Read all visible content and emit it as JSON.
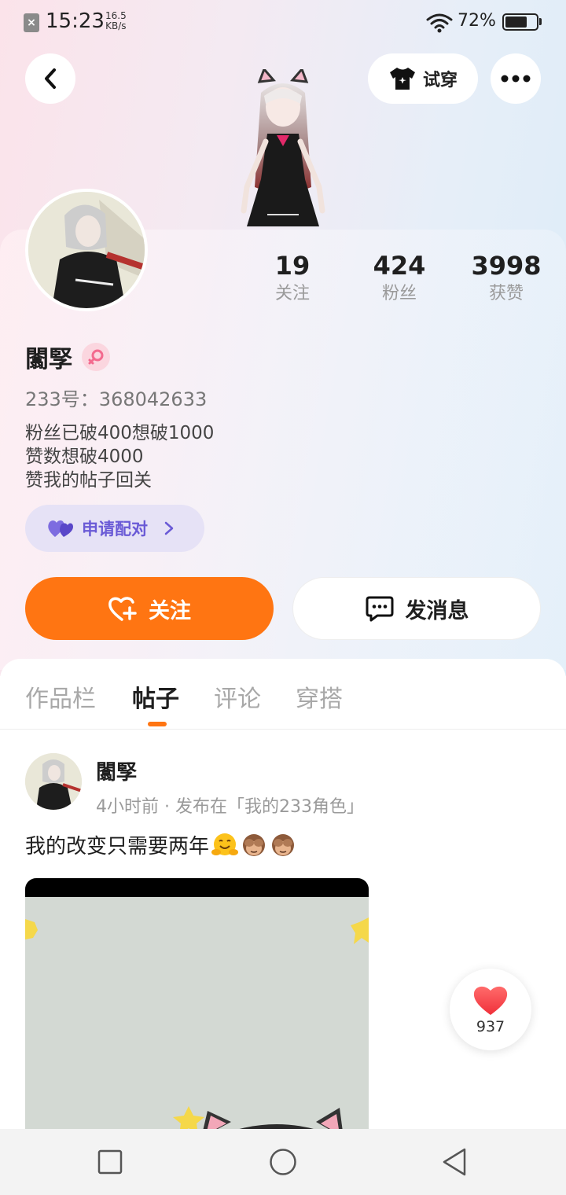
{
  "status_bar": {
    "time": "15:23",
    "net_speed_value": "16.5",
    "net_speed_unit": "KB/s",
    "battery_percent": "72%",
    "battery_level": 0.72,
    "icons": [
      "sim-disabled-icon",
      "wifi-icon",
      "battery-icon"
    ]
  },
  "header": {
    "try_on_label": "试穿",
    "icons": [
      "back-icon",
      "tshirt-icon",
      "more-icon"
    ]
  },
  "profile": {
    "username": "闟孯",
    "gender": "female",
    "uid_label": "233号：368042633",
    "bio_lines": [
      "粉丝已破400想破1000",
      "赞数想破4000",
      "赞我的帖子回关"
    ],
    "pair_label": "申请配对",
    "stats": [
      {
        "value": "19",
        "label": "关注"
      },
      {
        "value": "424",
        "label": "粉丝"
      },
      {
        "value": "3998",
        "label": "获赞"
      }
    ]
  },
  "actions": {
    "follow_label": "关注",
    "message_label": "发消息"
  },
  "tabs": [
    {
      "label": "作品栏",
      "active": false
    },
    {
      "label": "帖子",
      "active": true
    },
    {
      "label": "评论",
      "active": false
    },
    {
      "label": "穿搭",
      "active": false
    }
  ],
  "post": {
    "author": "闟孯",
    "meta": "4小时前 · 发布在「我的233角色」",
    "text": "我的改变只需要两年",
    "emojis": [
      "hugging-face-emoji",
      "see-no-evil-monkey-emoji",
      "see-no-evil-monkey-emoji"
    ],
    "like_count": "937"
  },
  "colors": {
    "accent": "#ff7512",
    "pair_purple": "#6a5ad6",
    "like_red": "#ff3b3b"
  }
}
